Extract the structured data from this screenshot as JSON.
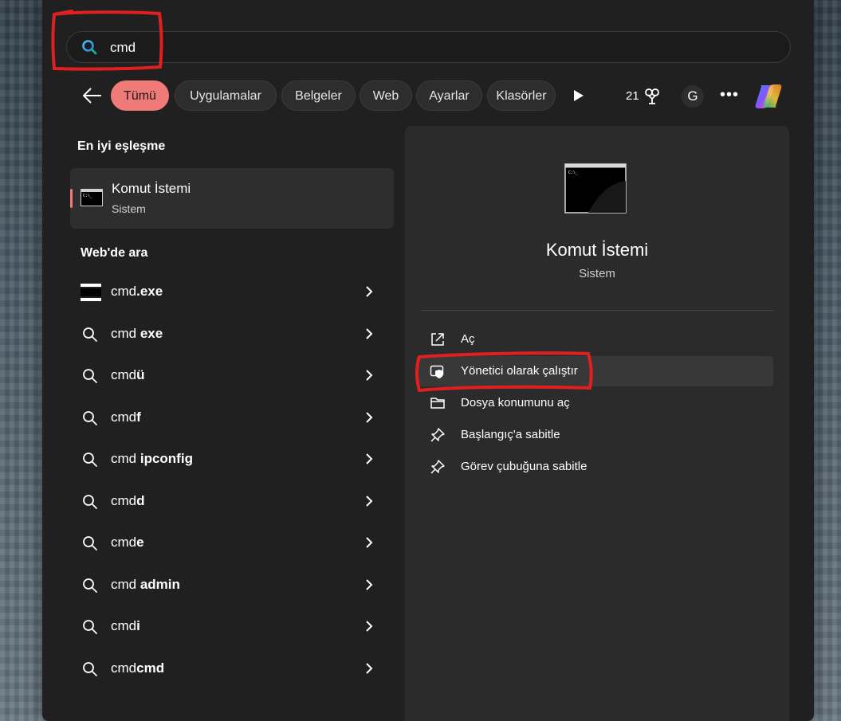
{
  "search": {
    "query": "cmd"
  },
  "filters": {
    "tabs": [
      "Tümü",
      "Uygulamalar",
      "Belgeler",
      "Web",
      "Ayarlar",
      "Klasörler"
    ],
    "active_tab": "Tümü",
    "points": "21",
    "avatar_letter": "G",
    "more": "•••"
  },
  "best_match": {
    "heading": "En iyi eşleşme",
    "title": "Komut İstemi",
    "subtitle": "Sistem"
  },
  "web": {
    "heading": "Web'de ara",
    "items": [
      {
        "prefix": "cmd",
        "suffix": ".exe",
        "icon": "cmd-exe-icon"
      },
      {
        "prefix": "cmd",
        "suffix": " exe",
        "icon": "search-icon"
      },
      {
        "prefix": "cmd",
        "suffix": "ü",
        "icon": "search-icon"
      },
      {
        "prefix": "cmd",
        "suffix": "f",
        "icon": "search-icon"
      },
      {
        "prefix": "cmd",
        "suffix": " ipconfig",
        "icon": "search-icon"
      },
      {
        "prefix": "cmd",
        "suffix": "d",
        "icon": "search-icon"
      },
      {
        "prefix": "cmd",
        "suffix": "e",
        "icon": "search-icon"
      },
      {
        "prefix": "cmd",
        "suffix": " admin",
        "icon": "search-icon"
      },
      {
        "prefix": "cmd",
        "suffix": "i",
        "icon": "search-icon"
      },
      {
        "prefix": "cmd",
        "suffix": "cmd",
        "icon": "search-icon"
      }
    ]
  },
  "preview": {
    "title": "Komut İstemi",
    "subtitle": "Sistem",
    "actions": [
      {
        "label": "Aç",
        "icon": "open-external-icon"
      },
      {
        "label": "Yönetici olarak çalıştır",
        "icon": "shield-admin-icon"
      },
      {
        "label": "Dosya konumunu aç",
        "icon": "folder-icon"
      },
      {
        "label": "Başlangıç'a sabitle",
        "icon": "pin-icon"
      },
      {
        "label": "Görev çubuğuna sabitle",
        "icon": "pin-icon"
      }
    ]
  },
  "colors": {
    "accent": "#f07a78",
    "panel": "#202020",
    "annotation_red": "#e02020"
  }
}
